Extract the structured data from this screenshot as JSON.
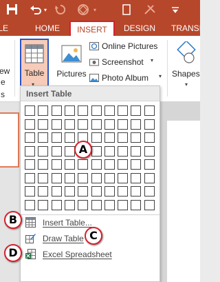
{
  "tabs": {
    "file": "ILE",
    "home": "HOME",
    "insert": "INSERT",
    "design": "DESIGN",
    "transitions": "TRANSI"
  },
  "ribbon": {
    "left_fragment_1": "ew",
    "left_fragment_2": "e",
    "left_fragment_3": "s",
    "table_label": "Table",
    "pictures_label": "Pictures",
    "online_pictures_label": "Online Pictures",
    "screenshot_label": "Screenshot",
    "photo_album_label": "Photo Album",
    "shapes_label": "Shapes"
  },
  "dropdown": {
    "header": "Insert Table",
    "grid_columns": 10,
    "grid_rows": 8,
    "items": [
      {
        "label": "Insert Table...",
        "icon": "insert-table-icon"
      },
      {
        "label": "Draw Table",
        "icon": "draw-table-icon"
      },
      {
        "label": "Excel Spreadsheet",
        "icon": "excel-spreadsheet-icon"
      }
    ]
  },
  "callouts": {
    "a": "A",
    "b": "B",
    "c": "C",
    "d": "D"
  },
  "colors": {
    "accent": "#b7472a",
    "callout_border": "#d9202a",
    "table_button_bg": "#f6cbb9",
    "table_button_border": "#2a55c4"
  }
}
